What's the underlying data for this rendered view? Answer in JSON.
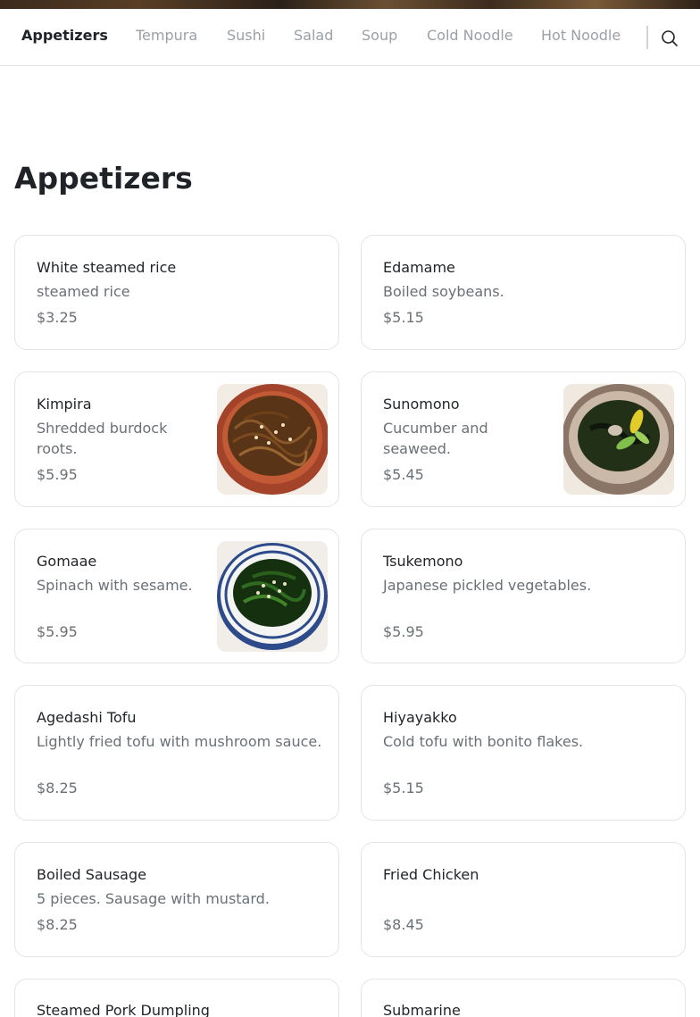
{
  "tabs": [
    {
      "label": "Appetizers",
      "active": true
    },
    {
      "label": "Tempura"
    },
    {
      "label": "Sushi"
    },
    {
      "label": "Salad"
    },
    {
      "label": "Soup"
    },
    {
      "label": "Cold Noodle"
    },
    {
      "label": "Hot Noodle"
    }
  ],
  "search_icon": "search-icon",
  "section": {
    "title": "Appetizers"
  },
  "items": [
    {
      "name": "White steamed rice",
      "desc": "steamed rice",
      "price": "$3.25"
    },
    {
      "name": "Edamame",
      "desc": "Boiled soybeans.",
      "price": "$5.15"
    },
    {
      "name": "Kimpira",
      "desc": "Shredded burdock roots.",
      "price": "$5.95",
      "image": "burdock-root-bowl"
    },
    {
      "name": "Sunomono",
      "desc": "Cucumber and seaweed.",
      "price": "$5.45",
      "image": "cucumber-seaweed-bowl"
    },
    {
      "name": "Gomaae",
      "desc": "Spinach with sesame.",
      "price": "$5.95",
      "image": "spinach-sesame-bowl"
    },
    {
      "name": "Tsukemono",
      "desc": "Japanese pickled vegetables.",
      "price": "$5.95"
    },
    {
      "name": "Agedashi Tofu",
      "desc": "Lightly fried tofu with mushroom sauce.",
      "price": "$8.25"
    },
    {
      "name": "Hiyayakko",
      "desc": "Cold tofu with bonito flakes.",
      "price": "$5.15"
    },
    {
      "name": "Boiled Sausage",
      "desc": "5 pieces. Sausage with mustard.",
      "price": "$8.25"
    },
    {
      "name": "Fried Chicken",
      "desc": "",
      "price": "$8.45"
    },
    {
      "name": "Steamed Pork Dumpling",
      "desc": "",
      "price": ""
    },
    {
      "name": "Submarine",
      "desc": "",
      "price": ""
    }
  ],
  "colors": {
    "accent": "#1f2328",
    "muted": "#6b7075",
    "tab_inactive": "#9aa0a6",
    "border": "#e2e4e7"
  }
}
